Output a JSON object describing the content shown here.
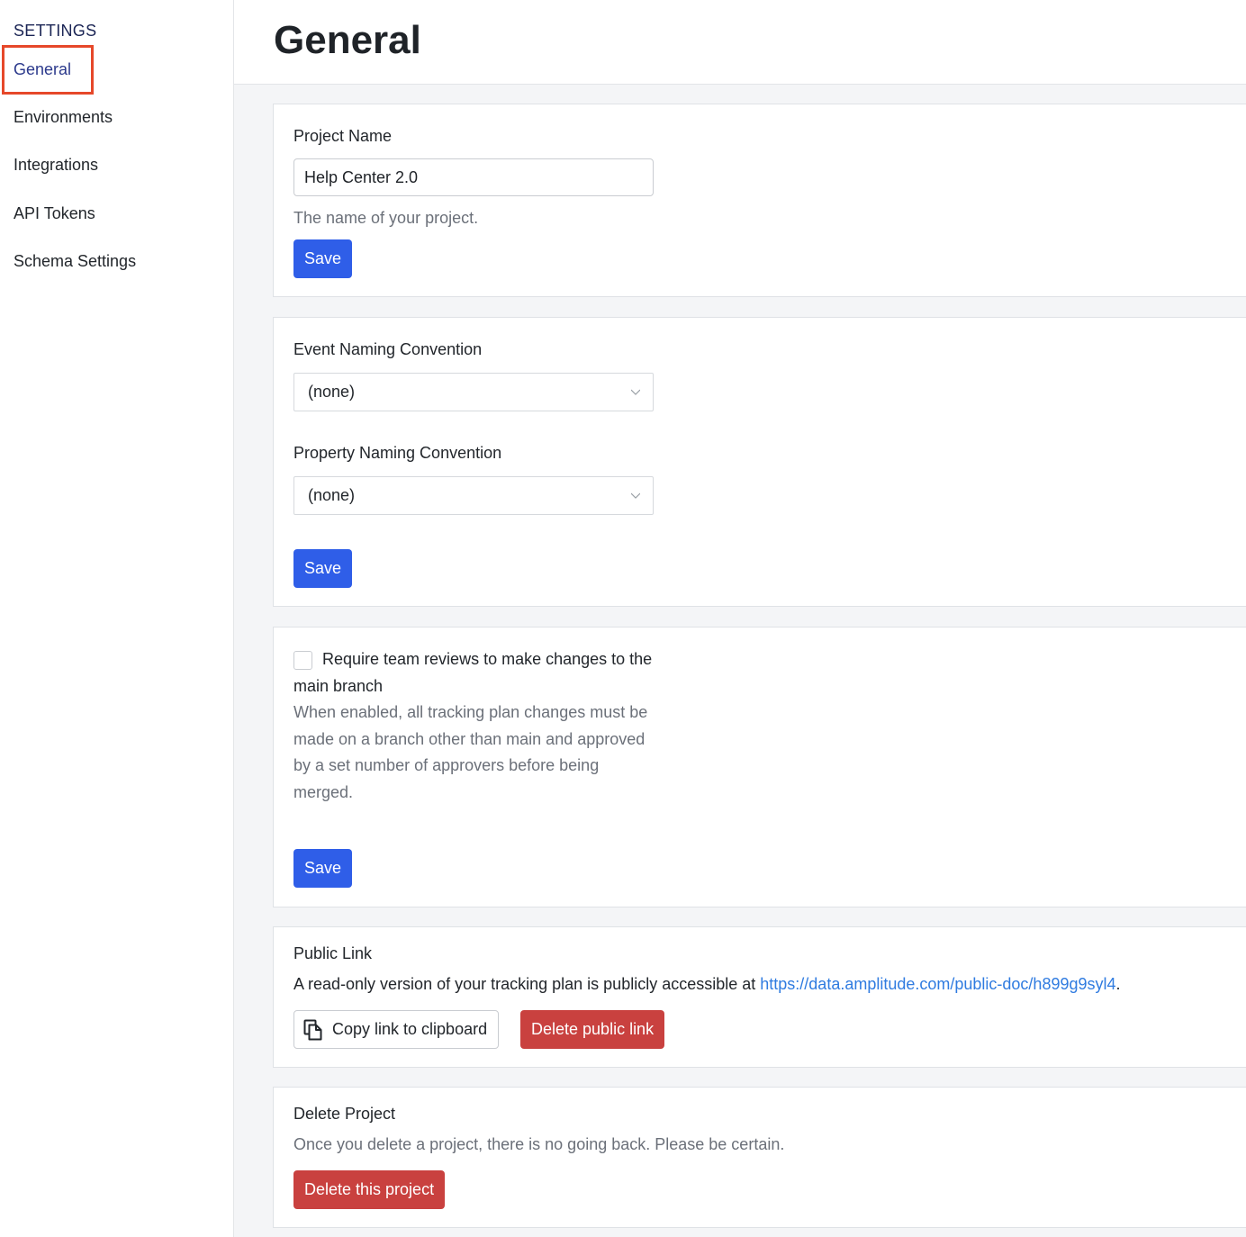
{
  "sidebar": {
    "heading": "SETTINGS",
    "items": [
      {
        "label": "General",
        "active": true
      },
      {
        "label": "Environments"
      },
      {
        "label": "Integrations"
      },
      {
        "label": "API Tokens"
      },
      {
        "label": "Schema Settings"
      }
    ]
  },
  "page": {
    "title": "General"
  },
  "project_name": {
    "label": "Project Name",
    "value": "Help Center 2.0",
    "help": "The name of your project.",
    "save_label": "Save"
  },
  "naming": {
    "event_label": "Event Naming Convention",
    "event_value": "(none)",
    "property_label": "Property Naming Convention",
    "property_value": "(none)",
    "save_label": "Save"
  },
  "reviews": {
    "checked": false,
    "label": "Require team reviews to make changes to the main branch",
    "help": "When enabled, all tracking plan changes must be made on a branch other than main and approved by a set number of approvers before being merged.",
    "save_label": "Save"
  },
  "public_link": {
    "title": "Public Link",
    "desc_prefix": "A read-only version of your tracking plan is publicly accessible at ",
    "url": "https://data.amplitude.com/public-doc/h899g9syl4",
    "desc_suffix": ".",
    "copy_label": "Copy link to clipboard",
    "delete_label": "Delete public link"
  },
  "delete_project": {
    "title": "Delete Project",
    "desc": "Once you delete a project, there is no going back. Please be certain.",
    "button_label": "Delete this project"
  },
  "colors": {
    "primary": "#2f5ee8",
    "danger": "#c9413f",
    "link": "#2f7be0",
    "highlight": "#e6482a"
  },
  "icons": {
    "select_chevron": "chevron-down-icon",
    "copy": "copy-icon"
  }
}
